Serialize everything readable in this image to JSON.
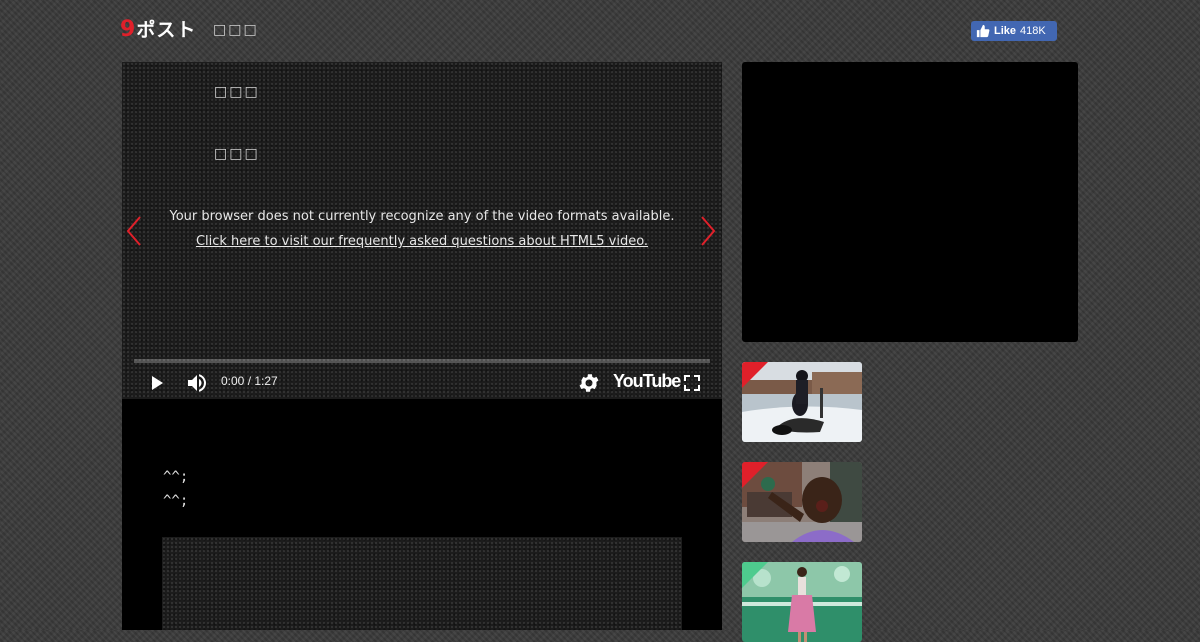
{
  "header": {
    "logo_mark": "9",
    "logo_text": "ポスト",
    "tagline": "□□□"
  },
  "facebook": {
    "like_label": "Like",
    "like_count": "418K"
  },
  "player": {
    "line_1": "□□□",
    "line_2": "□□□",
    "message": "Your browser does not currently recognize any of the video formats available.",
    "faq_link": "Click here to visit our frequently asked questions about HTML5 video.",
    "time": "0:00 / 1:27",
    "youtube_label": "YouTube",
    "progress": 0
  },
  "content": {
    "emote_1": "^^;",
    "emote_2": "^^;"
  },
  "sidebar": {
    "thumbnails": [
      {
        "subject": "person-on-snow-scooter"
      },
      {
        "subject": "man-shouting-outside-store"
      },
      {
        "subject": "woman-on-green-stage"
      }
    ]
  },
  "colors": {
    "accent": "#e0202a",
    "facebook": "#4267b2",
    "background": "#3b3b3b"
  },
  "icons": [
    "play-icon",
    "volume-icon",
    "settings-icon",
    "fullscreen-icon",
    "chevron-left-icon",
    "chevron-right-icon",
    "thumbs-up-icon"
  ]
}
